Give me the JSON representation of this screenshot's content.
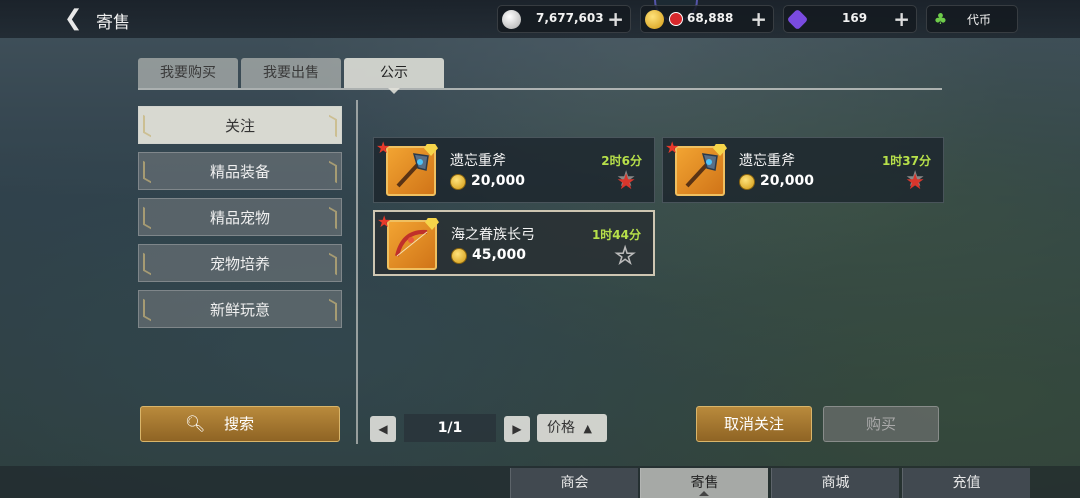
{
  "header": {
    "title": "寄售",
    "currencies": [
      {
        "icon": "silver-coin-icon",
        "value": "7,677,603"
      },
      {
        "icon": "gold-coin-icon",
        "value": "68,888"
      },
      {
        "icon": "purple-gem-icon",
        "value": "169"
      },
      {
        "icon": "clover-token-icon",
        "value": "代币"
      }
    ]
  },
  "tabs": [
    "我要购买",
    "我要出售",
    "公示"
  ],
  "active_tab": "公示",
  "categories": [
    "关注",
    "精品装备",
    "精品宠物",
    "宠物培养",
    "新鲜玩意"
  ],
  "active_category": "关注",
  "search_label": "搜索",
  "items": [
    {
      "name": "遗忘重斧",
      "price": "20,000",
      "time": "2时6分",
      "favorited": true,
      "icon": "battle-axe-icon"
    },
    {
      "name": "遗忘重斧",
      "price": "20,000",
      "time": "1时37分",
      "favorited": true,
      "icon": "battle-axe-icon"
    },
    {
      "name": "海之眷族长弓",
      "price": "45,000",
      "time": "1时44分",
      "favorited": false,
      "icon": "longbow-icon"
    }
  ],
  "pagination": {
    "page": "1/1",
    "sort_label": "价格"
  },
  "actions": {
    "unfollow": "取消关注",
    "buy": "购买"
  },
  "bottom_nav": [
    "商会",
    "寄售",
    "商城",
    "充值"
  ],
  "active_bottom": "寄售",
  "colors": {
    "gold": "#b98a3c",
    "time_green": "#b7e04a",
    "star_red": "#d8362c"
  }
}
